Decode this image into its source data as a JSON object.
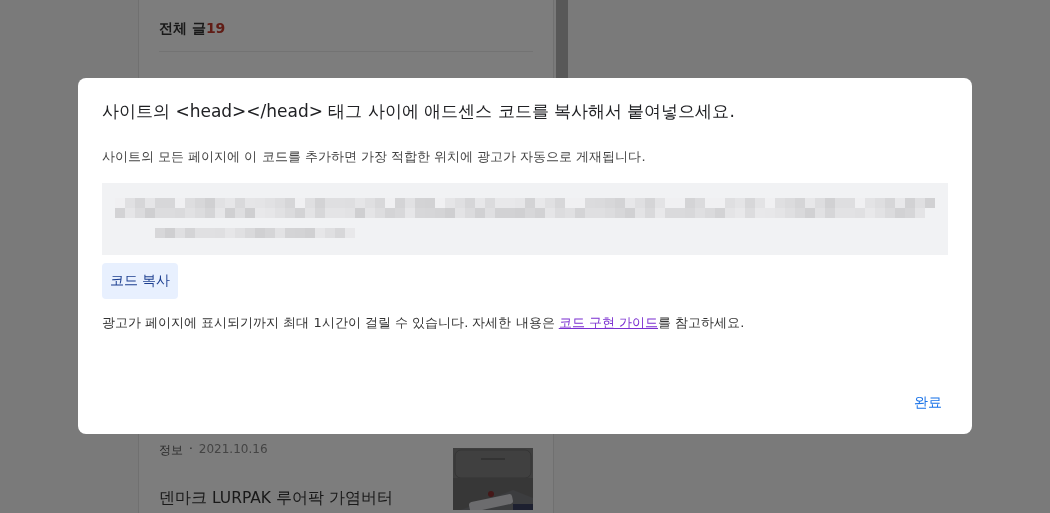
{
  "background": {
    "sidebar_heading": {
      "label": "전체 글",
      "count": "19"
    },
    "posts": [
      {
        "category": "정보",
        "separator": "·",
        "date": "2021.10.16"
      },
      {
        "title": "덴마크 LURPAK 루어팍 가염버터"
      }
    ]
  },
  "dialog": {
    "title": "사이트의 <head></head> 태그 사이에 애드센스 코드를 복사해서 붙여넣으세요.",
    "description": "사이트의 모든 페이지에 이 코드를 추가하면 가장 적합한 위치에 광고가 자동으로 게재됩니다.",
    "copy_button": "코드 복사",
    "note_before": "광고가 페이지에 표시되기까지 최대 1시간이 걸릴 수 있습니다. 자세한 내용은 ",
    "note_link": "코드 구현 가이드",
    "note_after": "를 참고하세요.",
    "done_button": "완료"
  }
}
